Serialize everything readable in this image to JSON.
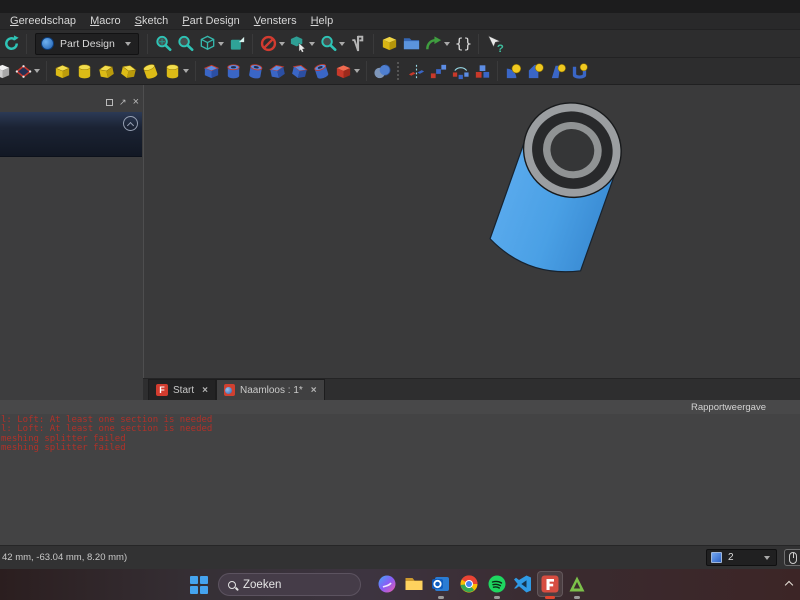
{
  "menubar": {
    "items": [
      {
        "label": "Gereedschap"
      },
      {
        "label": "Macro"
      },
      {
        "label": "Sketch"
      },
      {
        "label": "Part Design"
      },
      {
        "label": "Vensters"
      },
      {
        "label": "Help"
      }
    ]
  },
  "toolbars": {
    "workbench_selector": {
      "value": "Part Design"
    },
    "row1_icons": [
      "refresh-icon",
      "workbench-selector",
      "fit-all-icon",
      "fit-selection-icon",
      "draw-style-icon",
      "isometric-view-icon",
      "clipping-icon",
      "box-selection-icon",
      "zoom-tools-icon",
      "measure-icon",
      "create-part-icon",
      "create-group-icon",
      "make-link-icon",
      "varset-icon",
      "whatsthis-icon"
    ],
    "row2_icons": [
      "create-body-icon",
      "create-sketch-icon",
      "pad-icon",
      "revolve-icon",
      "additive-loft-icon",
      "additive-pipe-icon",
      "additive-helix-icon",
      "additive-primitive-icon",
      "pocket-icon",
      "hole-icon",
      "groove-icon",
      "subtractive-loft-icon",
      "subtractive-pipe-icon",
      "subtractive-helix-icon",
      "subtractive-primitive-icon",
      "boolean-icon",
      "mirrored-icon",
      "linear-pattern-icon",
      "polar-pattern-icon",
      "multitransform-icon",
      "fillet-icon",
      "chamfer-icon",
      "draft-icon",
      "thickness-icon"
    ]
  },
  "viewport": {
    "tabs": [
      {
        "label": "Start"
      },
      {
        "label": "Naamloos : 1*"
      }
    ],
    "model": {
      "type": "cylinder-with-bore",
      "body_color": "#4aa0e5",
      "cap_rim_color": "#9b9ea1",
      "cap_ring_dark": "#28292b",
      "cap_ring_gray": "#909394",
      "bore_color": "#353637",
      "background": "#3a3a3b"
    }
  },
  "report": {
    "title": "Rapportweergave",
    "lines": [
      "l: Loft: At least one section is needed",
      "l: Loft: At least one section is needed",
      "meshing splitter failed",
      "meshing splitter failed"
    ],
    "text_color": "#b13129"
  },
  "statusbar": {
    "coordinates": "42 mm, -63.04 mm, 8.20 mm)",
    "nav_value": "2"
  },
  "taskbar": {
    "search_label": "Zoeken",
    "apps": [
      "copilot-icon",
      "explorer-icon",
      "outlook-icon",
      "chrome-icon",
      "spotify-icon",
      "vscode-icon",
      "freecad-icon",
      "green-a-app-icon"
    ],
    "active_app": "freecad-icon",
    "accent_underline": "#e0452f"
  }
}
